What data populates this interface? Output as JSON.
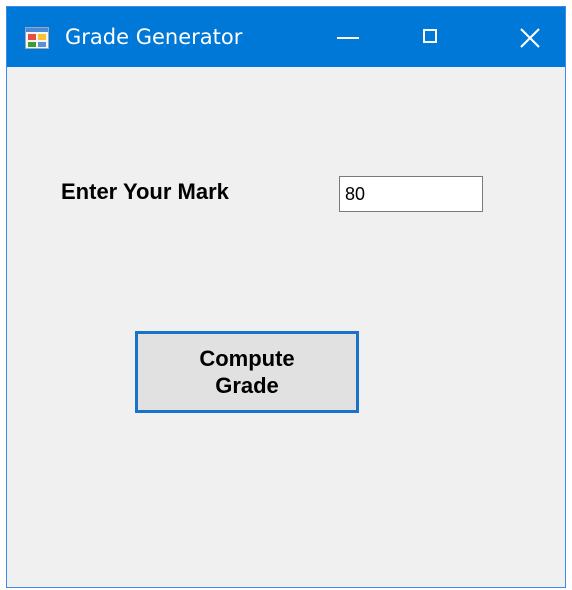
{
  "window": {
    "title": "Grade Generator",
    "icon": "form-app-icon",
    "controls": {
      "minimize_icon": "minimize-icon",
      "maximize_icon": "maximize-icon",
      "close_icon": "close-icon"
    }
  },
  "form": {
    "mark_label": "Enter Your Mark",
    "mark_value": "80",
    "compute_button_label": "Compute\nGrade"
  },
  "colors": {
    "titlebar": "#0078d7",
    "window_background": "#f0f0f0",
    "button_border": "#1a72c9",
    "button_face": "#e1e1e1"
  }
}
